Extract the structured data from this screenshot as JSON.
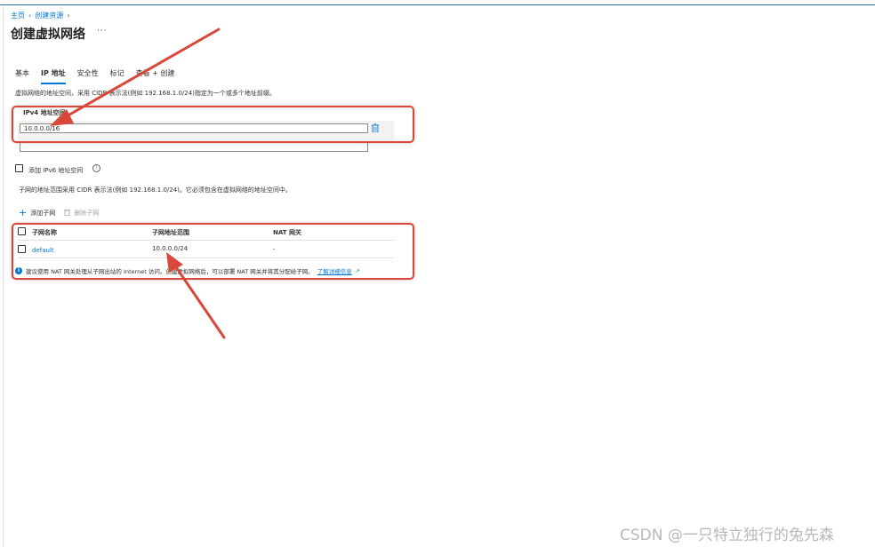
{
  "breadcrumb": {
    "home": "主页",
    "sep": "›",
    "create_resource": "创建资源"
  },
  "page": {
    "title": "创建虚拟网络",
    "more": "···"
  },
  "tabs": [
    "基本",
    "IP 地址",
    "安全性",
    "标记",
    "查看 + 创建"
  ],
  "active_tab": "IP 地址",
  "ip_description": "虚拟网络的地址空间，采用 CIDR 表示法(例如 192.168.1.0/24)指定为一个或多个地址前缀。",
  "ipv4": {
    "label": "IPv4 地址空间",
    "value": "10.0.0.0/16",
    "second_value": ""
  },
  "ipv6": {
    "label": "添加 IPv6 地址空间",
    "checked": false,
    "info_icon": "info-icon"
  },
  "subnet_description": "子网的地址范围采用 CIDR 表示法(例如 192.168.1.0/24)。它必须包含在虚拟网络的地址空间中。",
  "toolbar": {
    "add_subnet": "添加子网",
    "delete_subnet": "删除子网"
  },
  "subnet_table": {
    "columns": [
      "子网名称",
      "子网地址范围",
      "NAT 网关"
    ],
    "rows": [
      {
        "name": "default",
        "range": "10.0.0.0/24",
        "nat": "-"
      }
    ]
  },
  "nat_note": {
    "text": "建议使用 NAT 网关处理从子网出站的 Internet 访问。创建虚拟网络后，可以部署 NAT 网关并将其分配给子网。",
    "link": "了解详细信息"
  },
  "watermark": "CSDN @一只特立独行的兔先森",
  "colors": {
    "accent": "#0078d4",
    "annotation": "#d9473a",
    "text": "#323130"
  }
}
